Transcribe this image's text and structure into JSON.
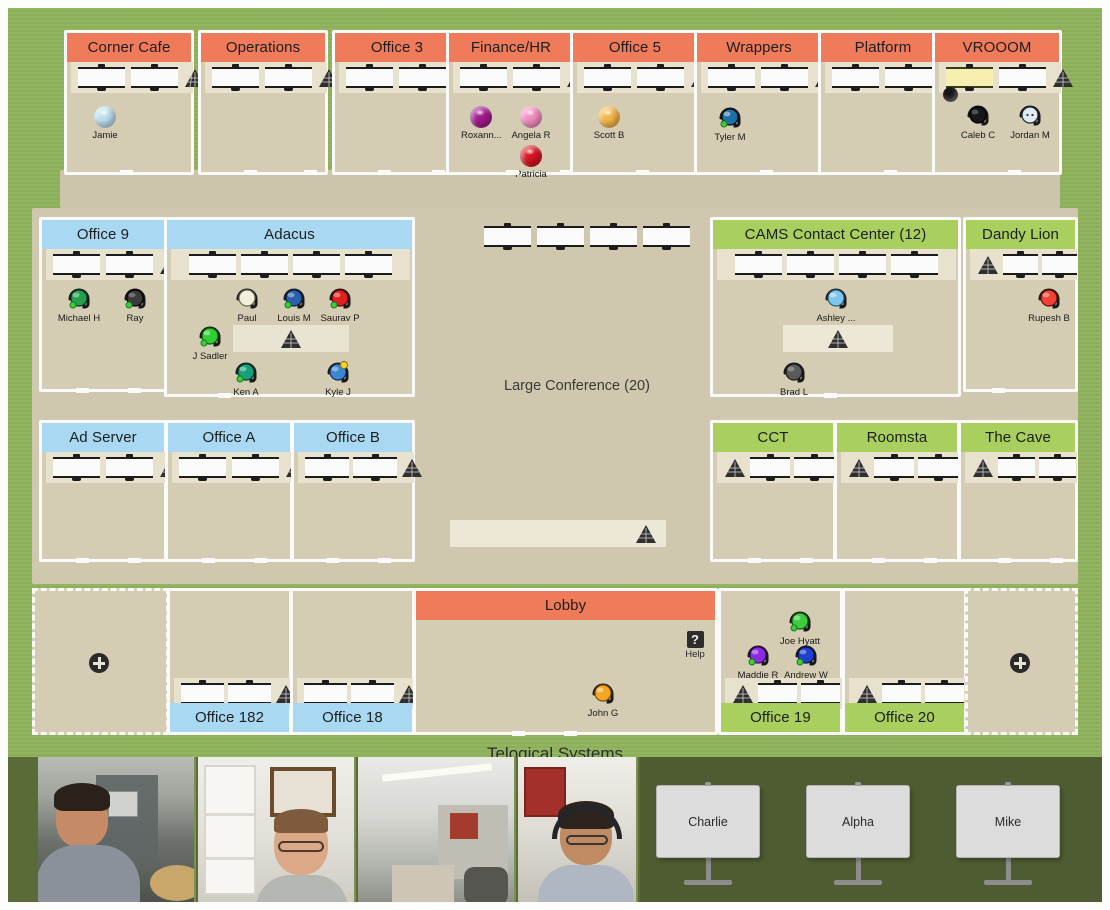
{
  "app": {
    "brand": "Telogical Systems",
    "conference_label": "Large Conference (20)",
    "help_label": "Help",
    "help_glyph": "?",
    "colors": {
      "grass": "#8fb25c",
      "floor": "#d4cdb4",
      "header_orange": "#ef7b5a",
      "header_blue": "#a9d9f2",
      "header_green": "#a9cf5e",
      "videobar": "#5b6b38"
    }
  },
  "rooms": [
    {
      "id": "corner-cafe",
      "name": "Corner Cafe",
      "header_color": "orange",
      "header_pos": "top",
      "desks": 2,
      "plant": "right",
      "occupants": [
        {
          "name": "Jamie",
          "color": "#bfe0ef",
          "style": "ball"
        }
      ]
    },
    {
      "id": "operations",
      "name": "Operations",
      "header_color": "orange",
      "header_pos": "top",
      "desks": 2,
      "plant": "right",
      "occupants": []
    },
    {
      "id": "office-3",
      "name": "Office 3",
      "header_color": "orange",
      "header_pos": "top",
      "desks": 2,
      "plant": "right",
      "occupants": []
    },
    {
      "id": "finance-hr",
      "name": "Finance/HR",
      "header_color": "orange",
      "header_pos": "top",
      "desks": 2,
      "plant": "right",
      "occupants": [
        {
          "name": "Roxann...",
          "color": "#a31a8c",
          "style": "ball"
        },
        {
          "name": "Angela R",
          "color": "#f58fc0",
          "style": "ball"
        },
        {
          "name": "Patricia",
          "color": "#d81423",
          "style": "ball"
        }
      ]
    },
    {
      "id": "office-5",
      "name": "Office 5",
      "header_color": "orange",
      "header_pos": "top",
      "desks": 2,
      "plant": "right",
      "occupants": [
        {
          "name": "Scott B",
          "color": "#f5b94a",
          "style": "ball"
        }
      ]
    },
    {
      "id": "wrappers",
      "name": "Wrappers",
      "header_color": "orange",
      "header_pos": "top",
      "desks": 2,
      "plant": "right",
      "occupants": [
        {
          "name": "Tyler M",
          "color": "#1c6fa8",
          "style": "headset"
        }
      ]
    },
    {
      "id": "platform",
      "name": "Platform",
      "header_color": "orange",
      "header_pos": "top",
      "desks": 2,
      "plant": "right",
      "occupants": []
    },
    {
      "id": "vrooom",
      "name": "VROOOM",
      "header_color": "orange",
      "header_pos": "top",
      "desks": 2,
      "plant": "right",
      "highlight_desk": 1,
      "occupants": [
        {
          "name": "Caleb C",
          "color": "#17171a",
          "style": "headset"
        },
        {
          "name": "Jordan M",
          "color": "#dfeaf2",
          "style": "headset"
        }
      ]
    },
    {
      "id": "office-9",
      "name": "Office 9",
      "header_color": "blue",
      "header_pos": "top",
      "desks": 2,
      "plant": "right",
      "occupants": [
        {
          "name": "Michael H",
          "color": "#24a04e",
          "style": "headset"
        },
        {
          "name": "Ray",
          "color": "#3b3b3b",
          "style": "headset"
        }
      ]
    },
    {
      "id": "adacus",
      "name": "Adacus",
      "header_color": "blue",
      "header_pos": "top",
      "desks": 4,
      "plant": "none",
      "occupants": [
        {
          "name": "Paul",
          "color": "#f2f0d8",
          "style": "headset"
        },
        {
          "name": "Louis M",
          "color": "#2a5fab",
          "style": "headset"
        },
        {
          "name": "Saurav P",
          "color": "#e01f1f",
          "style": "headset"
        },
        {
          "name": "J Sadler",
          "color": "#2fcf34",
          "style": "headset"
        },
        {
          "name": "Ken A",
          "color": "#17a07a",
          "style": "headset"
        },
        {
          "name": "Kyle J",
          "color": "#3c86d4",
          "style": "headset"
        }
      ]
    },
    {
      "id": "cams-contact-center",
      "name": "CAMS Contact Center (12)",
      "header_color": "green",
      "header_pos": "top",
      "desks": 4,
      "plant": "none",
      "occupants": [
        {
          "name": "Ashley ...",
          "color": "#7dc7ea",
          "style": "headset"
        },
        {
          "name": "Brad L",
          "color": "#5a5a5a",
          "style": "headset"
        }
      ]
    },
    {
      "id": "dandy-lion",
      "name": "Dandy Lion",
      "header_color": "green",
      "header_pos": "top",
      "desks": 2,
      "plant": "left",
      "occupants": [
        {
          "name": "Rupesh B",
          "color": "#ef4233",
          "style": "headset"
        }
      ]
    },
    {
      "id": "ad-server",
      "name": "Ad Server",
      "header_color": "blue",
      "header_pos": "top",
      "desks": 2,
      "plant": "right",
      "occupants": []
    },
    {
      "id": "office-a",
      "name": "Office A",
      "header_color": "blue",
      "header_pos": "top",
      "desks": 2,
      "plant": "right",
      "occupants": []
    },
    {
      "id": "office-b",
      "name": "Office B",
      "header_color": "blue",
      "header_pos": "top",
      "desks": 2,
      "plant": "right",
      "occupants": []
    },
    {
      "id": "cct",
      "name": "CCT",
      "header_color": "green",
      "header_pos": "top",
      "desks": 2,
      "plant": "left",
      "occupants": []
    },
    {
      "id": "roomsta",
      "name": "Roomsta",
      "header_color": "green",
      "header_pos": "top",
      "desks": 2,
      "plant": "left",
      "occupants": []
    },
    {
      "id": "the-cave",
      "name": "The Cave",
      "header_color": "green",
      "header_pos": "top",
      "desks": 2,
      "plant": "left",
      "occupants": []
    },
    {
      "id": "office-182",
      "name": "Office 182",
      "header_color": "blue",
      "header_pos": "bottom",
      "desks": 2,
      "plant": "right",
      "occupants": []
    },
    {
      "id": "office-18",
      "name": "Office 18",
      "header_color": "blue",
      "header_pos": "bottom",
      "desks": 2,
      "plant": "right",
      "occupants": []
    },
    {
      "id": "lobby",
      "name": "Lobby",
      "header_color": "orange",
      "header_pos": "top",
      "desks": 0,
      "plant": "none",
      "occupants": [
        {
          "name": "John G",
          "color": "#f5a623",
          "style": "headset"
        }
      ]
    },
    {
      "id": "office-19",
      "name": "Office 19",
      "header_color": "green",
      "header_pos": "bottom",
      "desks": 2,
      "plant": "left",
      "occupants": [
        {
          "name": "Joe Hyatt",
          "color": "#3ccc3c",
          "style": "headset"
        },
        {
          "name": "Maddie R",
          "color": "#8a2be2",
          "style": "headset"
        },
        {
          "name": "Andrew W",
          "color": "#1f3fcf",
          "style": "headset"
        }
      ]
    },
    {
      "id": "office-20",
      "name": "Office 20",
      "header_color": "green",
      "header_pos": "bottom",
      "desks": 2,
      "plant": "left",
      "occupants": []
    }
  ],
  "expansion_zones": [
    {
      "id": "add-room-left",
      "label": "+"
    },
    {
      "id": "add-room-right",
      "label": "+"
    }
  ],
  "video_feeds": [
    {
      "id": "feed-1",
      "label": ""
    },
    {
      "id": "feed-2",
      "label": ""
    },
    {
      "id": "feed-3",
      "label": ""
    },
    {
      "id": "feed-4",
      "label": ""
    }
  ],
  "screens": [
    {
      "id": "screen-charlie",
      "label": "Charlie"
    },
    {
      "id": "screen-alpha",
      "label": "Alpha"
    },
    {
      "id": "screen-mike",
      "label": "Mike"
    }
  ]
}
